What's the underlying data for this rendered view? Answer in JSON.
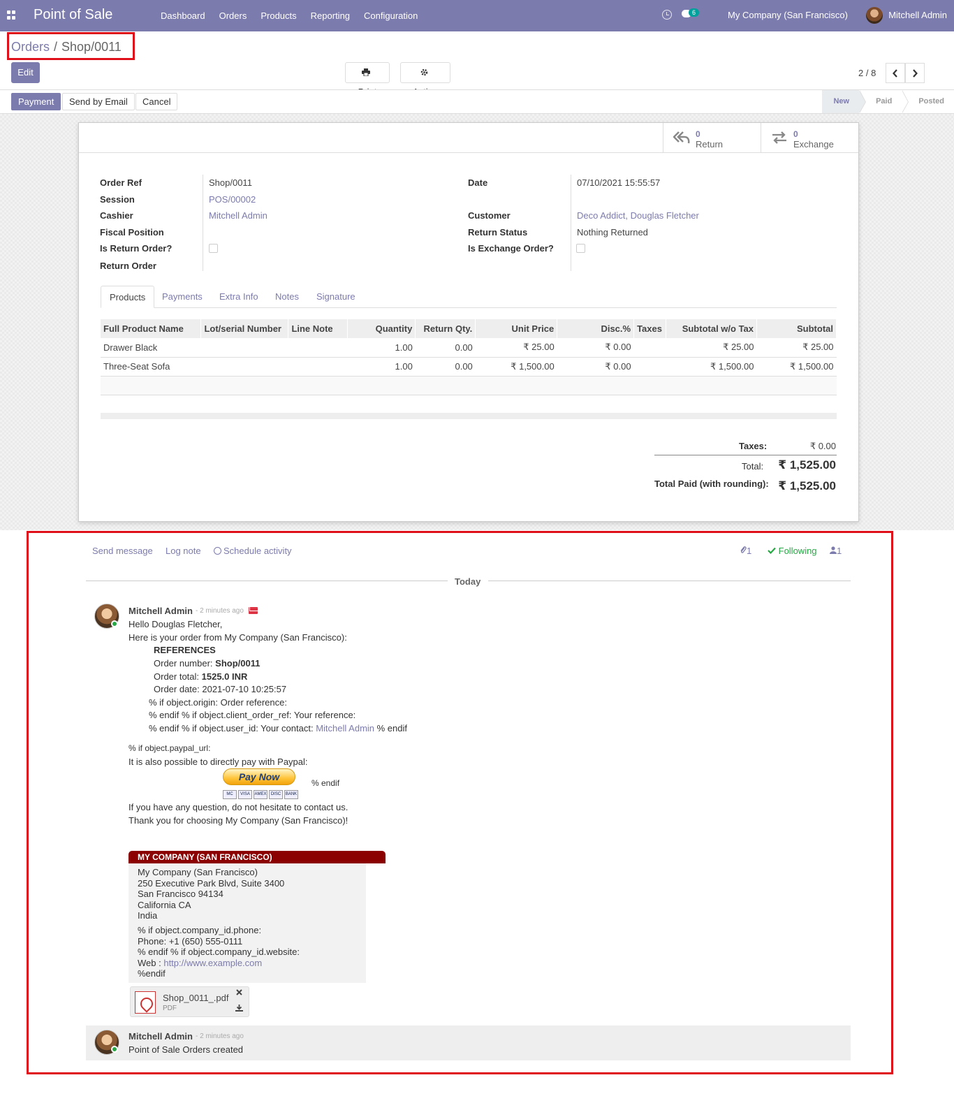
{
  "navbar": {
    "brand": "Point of Sale",
    "menu": [
      "Dashboard",
      "Orders",
      "Products",
      "Reporting",
      "Configuration"
    ],
    "chat_count": "6",
    "company": "My Company (San Francisco)",
    "user": "Mitchell Admin"
  },
  "breadcrumb": {
    "parent": "Orders",
    "sep": "/",
    "current": "Shop/0011"
  },
  "controls": {
    "edit": "Edit",
    "print": "Print",
    "action": "Action",
    "pager": "2 / 8"
  },
  "statusbar": {
    "payment": "Payment",
    "send_email": "Send by Email",
    "cancel": "Cancel",
    "stages": [
      "New",
      "Paid",
      "Posted"
    ],
    "active_stage": "New"
  },
  "smart_buttons": {
    "return": {
      "value": "0",
      "label": "Return"
    },
    "exchange": {
      "value": "0",
      "label": "Exchange"
    }
  },
  "fields": {
    "order_ref": {
      "label": "Order Ref",
      "value": "Shop/0011"
    },
    "session": {
      "label": "Session",
      "value": "POS/00002"
    },
    "cashier": {
      "label": "Cashier",
      "value": "Mitchell Admin"
    },
    "fiscal_position": {
      "label": "Fiscal Position",
      "value": ""
    },
    "is_return_order": {
      "label": "Is Return Order?",
      "checked": false
    },
    "return_order": {
      "label": "Return Order",
      "value": ""
    },
    "date": {
      "label": "Date",
      "value": "07/10/2021 15:55:57"
    },
    "customer": {
      "label": "Customer",
      "value": "Deco Addict, Douglas Fletcher"
    },
    "return_status": {
      "label": "Return Status",
      "value": "Nothing Returned"
    },
    "is_exchange_order": {
      "label": "Is Exchange Order?",
      "checked": false
    }
  },
  "tabs": [
    "Products",
    "Payments",
    "Extra Info",
    "Notes",
    "Signature"
  ],
  "lines": {
    "columns": [
      "Full Product Name",
      "Lot/serial Number",
      "Line Note",
      "Quantity",
      "Return Qty.",
      "Unit Price",
      "Disc.%",
      "Taxes",
      "Subtotal w/o Tax",
      "Subtotal"
    ],
    "rows": [
      [
        "Drawer Black",
        "",
        "",
        "1.00",
        "0.00",
        "₹ 25.00",
        "₹ 0.00",
        "",
        "₹ 25.00",
        "₹ 25.00"
      ],
      [
        "Three-Seat Sofa",
        "",
        "",
        "1.00",
        "0.00",
        "₹ 1,500.00",
        "₹ 0.00",
        "",
        "₹ 1,500.00",
        "₹ 1,500.00"
      ]
    ]
  },
  "totals": {
    "taxes_label": "Taxes:",
    "taxes": "₹ 0.00",
    "total_label": "Total:",
    "total": "₹ 1,525.00",
    "paid_label": "Total Paid (with rounding):",
    "paid": "₹ 1,525.00"
  },
  "chatter": {
    "send_message": "Send message",
    "log_note": "Log note",
    "schedule_activity": "Schedule activity",
    "attachments_count": "1",
    "following": "Following",
    "followers_count": "1",
    "today": "Today"
  },
  "message": {
    "author": "Mitchell Admin",
    "date": "- 2 minutes ago",
    "greeting": "Hello Douglas Fletcher,",
    "intro": "Here is your order from My Company (San Francisco):",
    "references": "REFERENCES",
    "order_number_label": "Order number: ",
    "order_number": "Shop/0011",
    "order_total_label": "Order total: ",
    "order_total": "1525.0 INR",
    "order_date": "Order date: 2021-07-10 10:25:57",
    "line_origin": "% if object.origin:   Order reference:",
    "line_client_ref": "% endif % if object.client_order_ref:   Your reference:",
    "line_user_pre": "% endif % if object.user_id:   Your contact: ",
    "line_user_link": "Mitchell Admin",
    "line_user_post": " % endif",
    "paypal_if": "% if object.paypal_url:",
    "paypal_text": "It is also possible to directly pay with Paypal:",
    "pay_now": "Pay Now",
    "paypal_endif": "% endif",
    "cards": [
      "MC",
      "VISA",
      "AMEX",
      "DISC",
      "BANK"
    ],
    "question": "If you have any question, do not hesitate to contact us.",
    "thanks": "Thank you for choosing My Company (San Francisco)!",
    "company_header": "MY COMPANY (SAN FRANCISCO)",
    "company_lines": [
      "My Company (San Francisco)",
      "250 Executive Park Blvd, Suite 3400",
      "San Francisco 94134",
      "California CA",
      "India"
    ],
    "phone_if": "% if object.company_id.phone:",
    "phone": "Phone:  +1 (650) 555-0111",
    "web_if": "% endif % if object.company_id.website:",
    "web_label": "Web : ",
    "web_link": "http://www.example.com",
    "endif": "%endif",
    "attachment_name": "Shop_0011_.pdf",
    "attachment_type": "PDF"
  },
  "notification": {
    "author": "Mitchell Admin",
    "date": "- 2 minutes ago",
    "text": "Point of Sale Orders created"
  }
}
